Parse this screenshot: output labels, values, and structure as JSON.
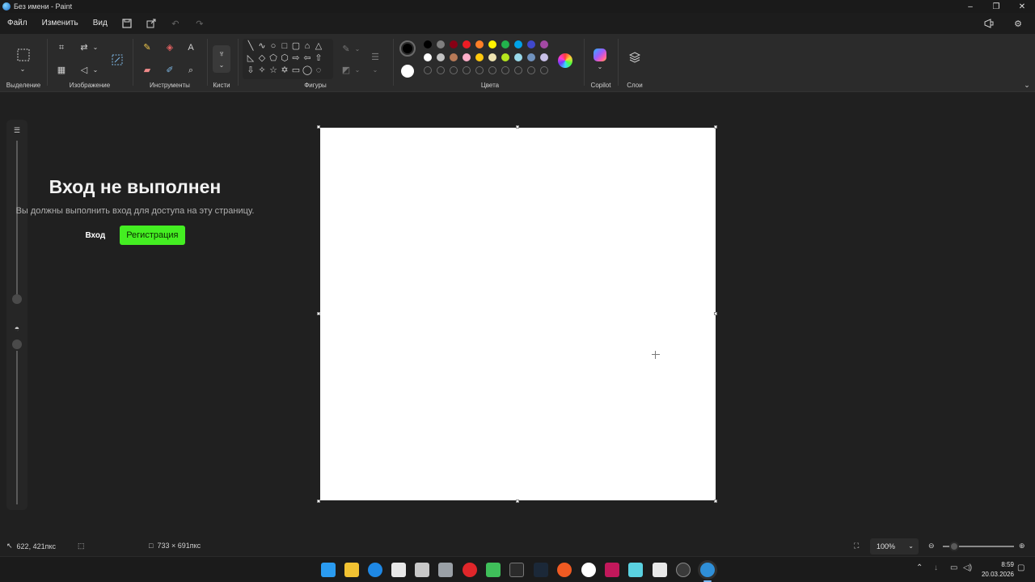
{
  "window": {
    "title": "Без имени - Paint",
    "controls": [
      "–",
      "❐",
      "✕"
    ]
  },
  "menu": {
    "items": [
      "Файл",
      "Изменить",
      "Вид"
    ]
  },
  "ribbon": {
    "groups": {
      "selection": "Выделение",
      "image": "Изображение",
      "tools": "Инструменты",
      "brushes": "Кисти",
      "shapes": "Фигуры",
      "colors": "Цвета",
      "copilot": "Copilot",
      "layers": "Слои"
    },
    "primary_color": "#000000",
    "secondary_color": "#ffffff",
    "palette_row1": [
      "#000000",
      "#7f7f7f",
      "#880015",
      "#ed1c24",
      "#ff7f27",
      "#fff200",
      "#22b14c",
      "#00a2e8",
      "#3f48cc",
      "#a349a4"
    ],
    "palette_row2": [
      "#ffffff",
      "#c3c3c3",
      "#b97a57",
      "#ffaec9",
      "#ffc90e",
      "#efe4b0",
      "#b5e61d",
      "#99d9ea",
      "#7092be",
      "#c8bfe7"
    ]
  },
  "overlay": {
    "title": "Вход не выполнен",
    "description": "Вы должны выполнить вход для доступа на эту страницу.",
    "login_link": "Вход",
    "register_button": "Регистрация"
  },
  "status": {
    "cursor_position": "622, 421пкс",
    "canvas_size": "733 × 691пкс",
    "zoom": "100%"
  },
  "taskbar": {
    "time": "8:59",
    "date": "20.03.2026"
  }
}
